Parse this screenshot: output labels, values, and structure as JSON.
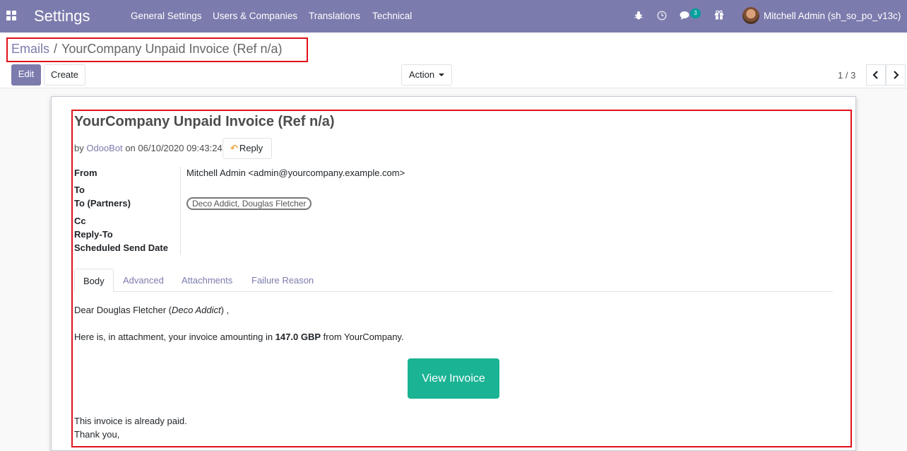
{
  "navbar": {
    "app_title": "Settings",
    "menu": [
      "General Settings",
      "Users & Companies",
      "Translations",
      "Technical"
    ],
    "messages_count": "3",
    "user_name": "Mitchell Admin (sh_so_po_v13c)",
    "icons": [
      "apps-icon",
      "bug-icon",
      "clock-icon",
      "chat-icon",
      "gift-icon",
      "avatar"
    ],
    "color": "#7c7bad"
  },
  "breadcrumb": {
    "parent": "Emails",
    "separator": "/",
    "current": "YourCompany Unpaid Invoice (Ref n/a)"
  },
  "toolbar": {
    "edit_label": "Edit",
    "create_label": "Create",
    "action_label": "Action",
    "pager": "1 / 3",
    "prev_icon": "chevron-left-icon",
    "next_icon": "chevron-right-icon"
  },
  "mail": {
    "title": "YourCompany Unpaid Invoice (Ref n/a)",
    "by_prefix": "by",
    "author": "OdooBot",
    "date_prefix": "on",
    "date": "06/10/2020 09:43:24",
    "reply_label": "Reply",
    "fields": {
      "from_label": "From",
      "from_value": "Mitchell Admin <admin@yourcompany.example.com>",
      "to_label": "To",
      "to_partners_label": "To (Partners)",
      "to_partners_value": "Deco Addict, Douglas Fletcher",
      "cc_label": "Cc",
      "reply_to_label": "Reply-To",
      "scheduled_label": "Scheduled Send Date"
    },
    "tabs": [
      "Body",
      "Advanced",
      "Attachments",
      "Failure Reason"
    ],
    "active_tab": "Body",
    "body": {
      "greeting_name": "Dear Douglas Fletcher (",
      "greeting_company": "Deco Addict",
      "greeting_end": ") ,",
      "line1_pre": "Here is, in attachment, your invoice amounting in ",
      "line1_amount": "147.0 GBP",
      "line1_post": " from YourCompany.",
      "button_label": "View Invoice",
      "paid_note": "This invoice is already paid.",
      "thanks": "Thank you,"
    }
  },
  "accent_colors": {
    "button": "#1ab394",
    "highlight": "#e0111a",
    "link": "#7c7bad"
  }
}
